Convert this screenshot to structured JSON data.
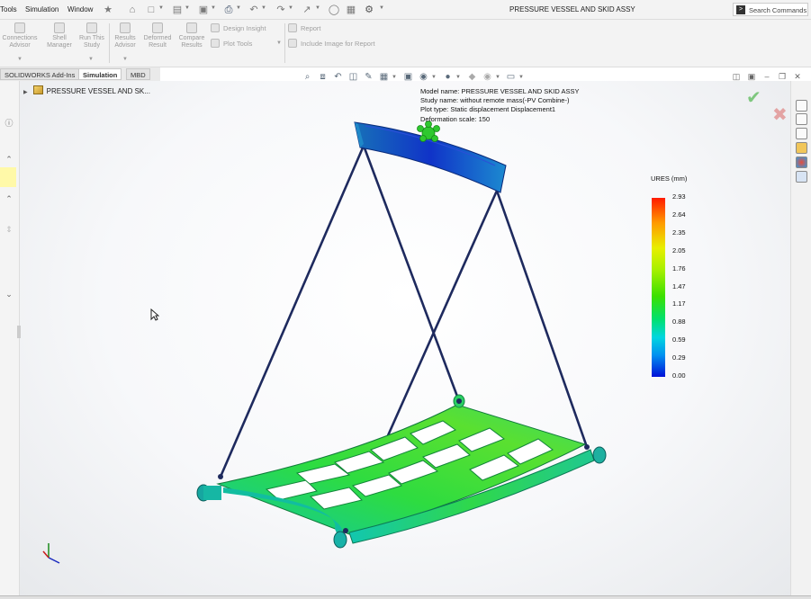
{
  "menu": {
    "items": [
      "Tools",
      "Simulation",
      "Window"
    ]
  },
  "document": {
    "title": "PRESSURE VESSEL AND SKID ASSY"
  },
  "search": {
    "label": "Search Commands"
  },
  "ribbon": {
    "buttons": [
      {
        "label": "Connections Advisor"
      },
      {
        "label": "Shell Manager"
      },
      {
        "label": "Run This Study"
      },
      {
        "label": "Results Advisor"
      },
      {
        "label": "Deformed Result"
      },
      {
        "label": "Compare Results"
      }
    ],
    "design_insight": "Design Insight",
    "plot_tools": "Plot Tools",
    "report": "Report",
    "include_image": "Include Image for Report"
  },
  "tabs": [
    "SOLIDWORKS Add-Ins",
    "Simulation",
    "MBD"
  ],
  "tree": {
    "root_label": "PRESSURE VESSEL AND SK..."
  },
  "plot_info": {
    "model_name": "Model name: PRESSURE VESSEL AND SKID ASSY",
    "study_name": "Study name: without remote mass(-PV Combine-)",
    "plot_type": "Plot type: Static displacement Displacement1",
    "deformation_scale": "Deformation scale: 150"
  },
  "legend": {
    "title": "URES (mm)",
    "values": [
      "2.93",
      "2.64",
      "2.35",
      "2.05",
      "1.76",
      "1.47",
      "1.17",
      "0.88",
      "0.59",
      "0.29",
      "0.00"
    ],
    "colors": {
      "max": "#ff1a00",
      "mid": "#3ce000",
      "min": "#0010d8"
    }
  },
  "icons": {
    "home": "home-icon",
    "cursor": "cursor-arrow-icon",
    "ok": "check-icon",
    "cancel": "close-icon"
  }
}
